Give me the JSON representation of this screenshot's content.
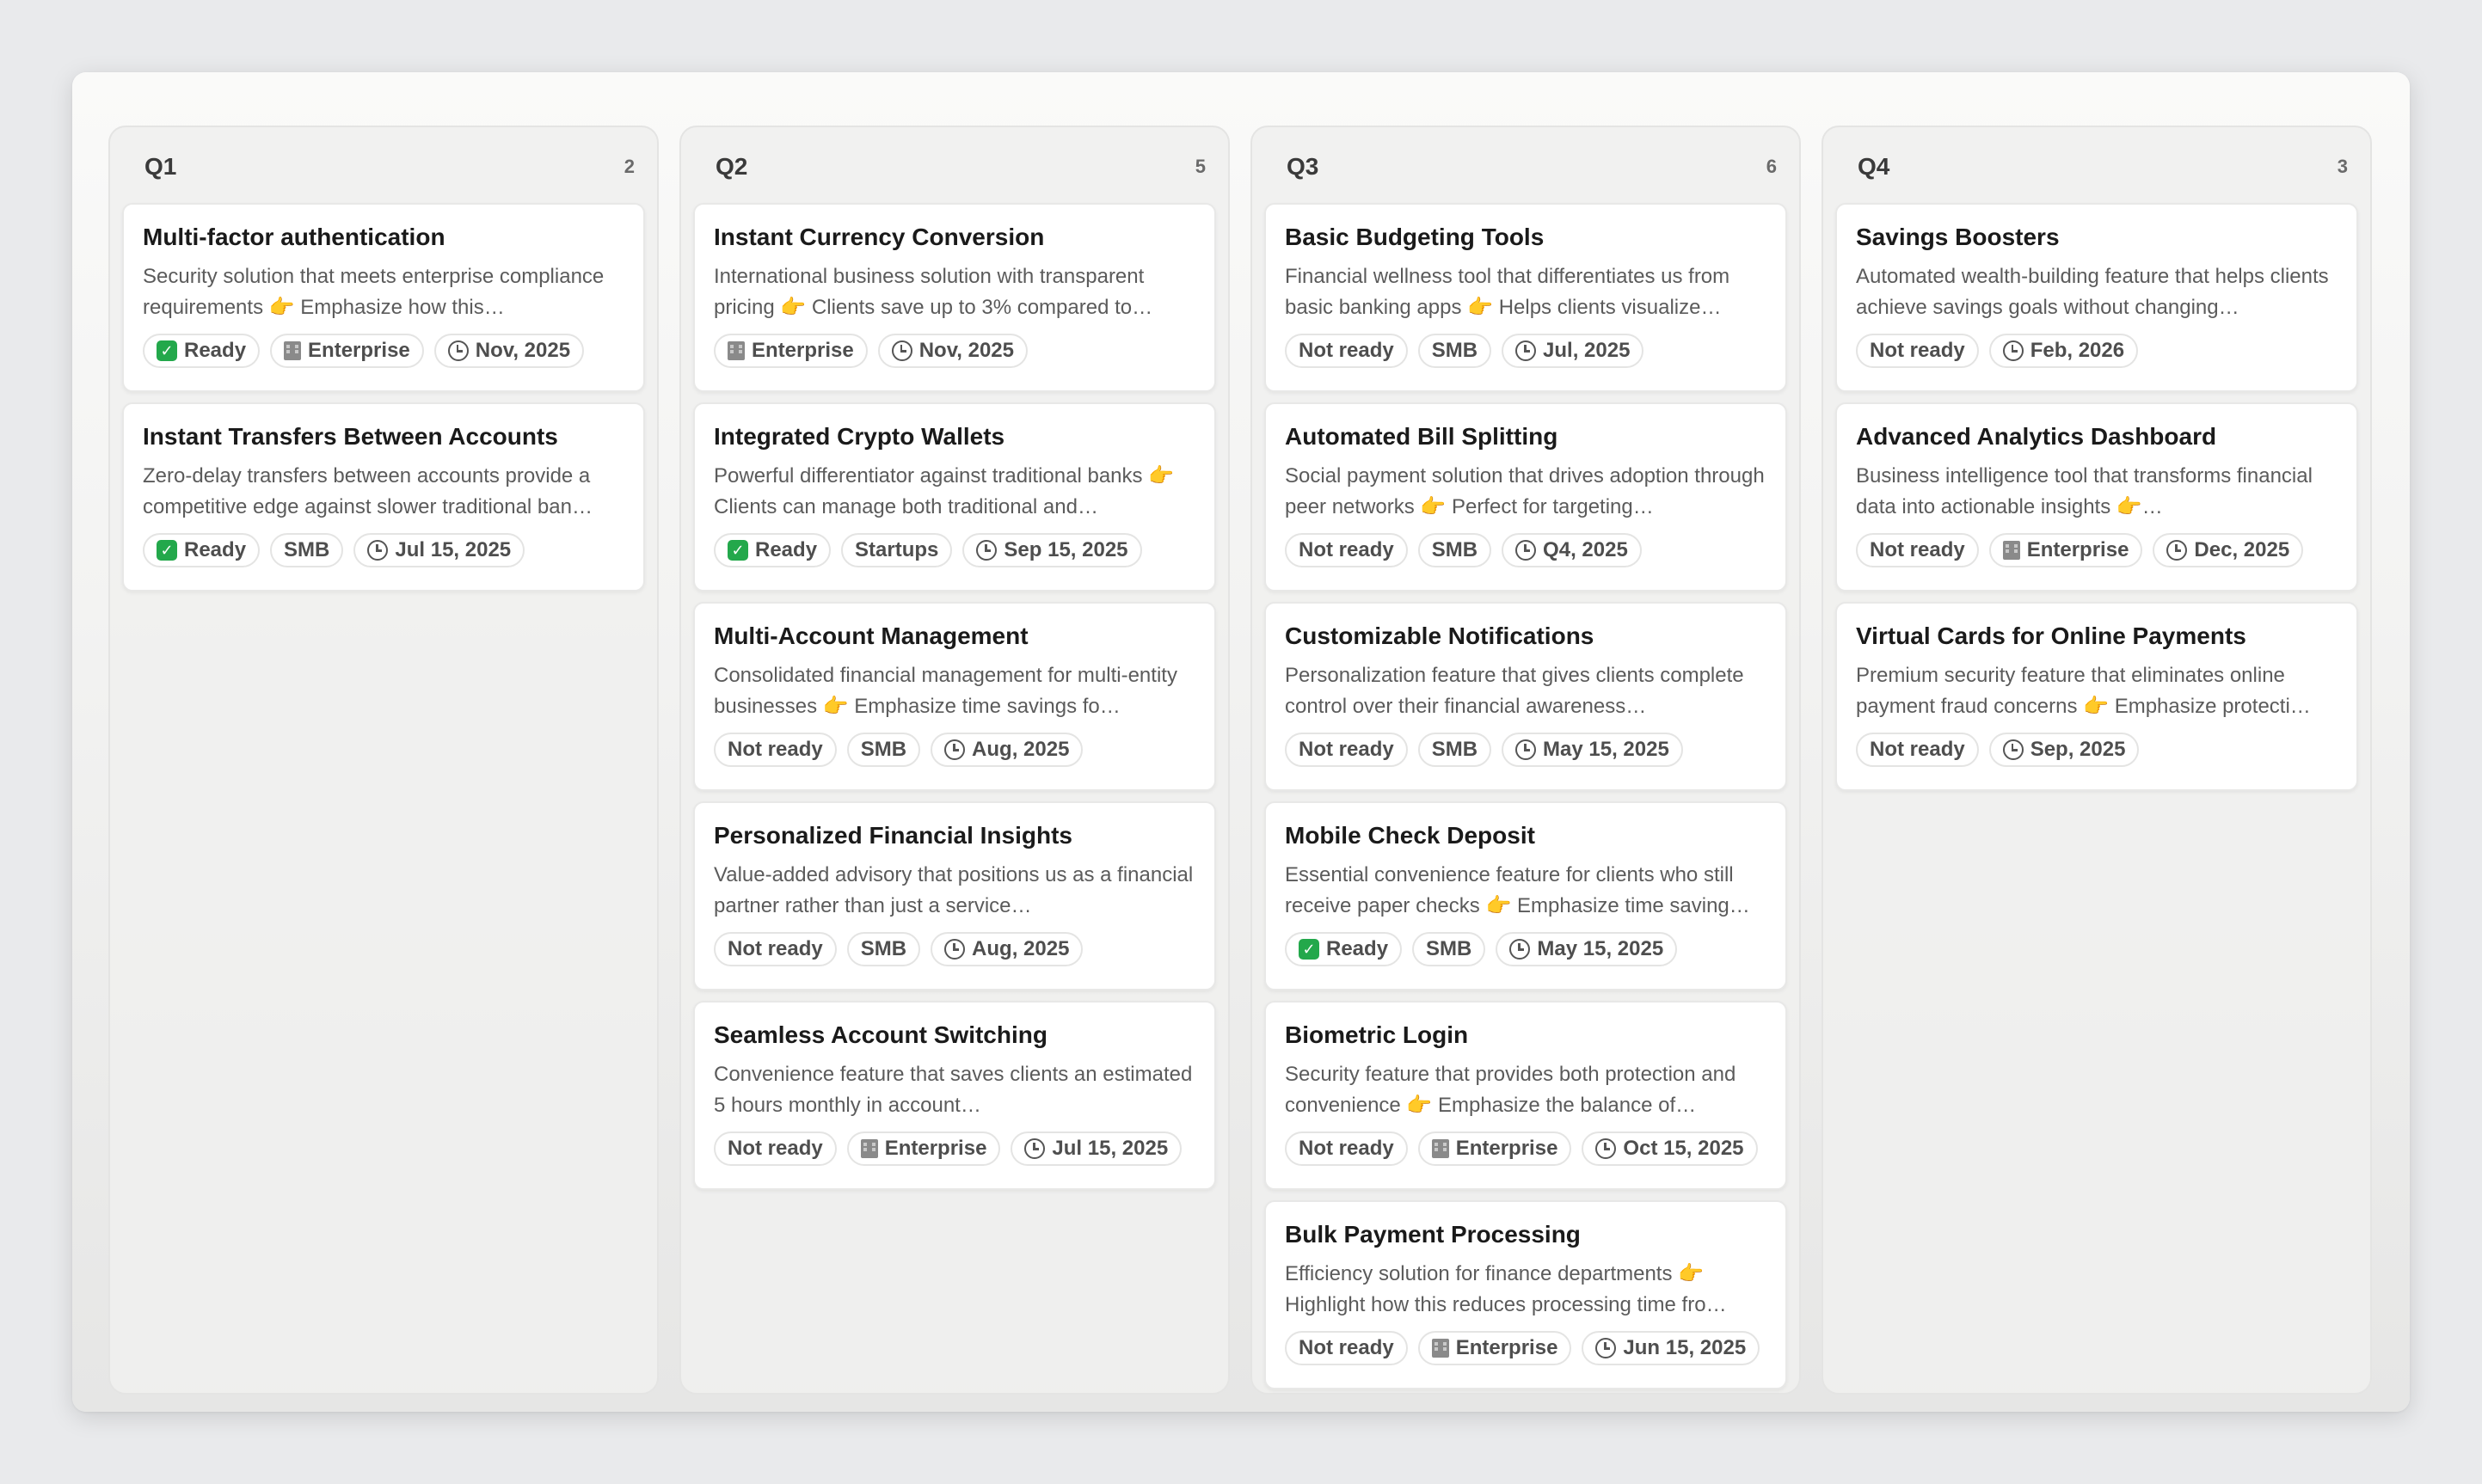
{
  "columns": [
    {
      "title": "Q1",
      "count": "2",
      "cards": [
        {
          "title": "Multi-factor authentication",
          "description": "Security solution that meets enterprise compliance requirements 👉 Emphasize how this…",
          "status": "Ready",
          "segment": "Enterprise",
          "date": "Nov, 2025"
        },
        {
          "title": "Instant Transfers Between Accounts",
          "description": "Zero-delay transfers between accounts provide a competitive edge against slower traditional ban…",
          "status": "Ready",
          "segment": "SMB",
          "date": "Jul 15, 2025"
        }
      ]
    },
    {
      "title": "Q2",
      "count": "5",
      "cards": [
        {
          "title": "Instant Currency Conversion",
          "description": "International business solution with transparent pricing 👉 Clients save up to 3% compared to…",
          "status": null,
          "segment": "Enterprise",
          "date": "Nov, 2025"
        },
        {
          "title": "Integrated Crypto Wallets",
          "description": "Powerful differentiator against traditional banks 👉 Clients can manage both traditional and…",
          "status": "Ready",
          "segment": "Startups",
          "date": "Sep 15, 2025"
        },
        {
          "title": "Multi-Account Management",
          "description": "Consolidated financial management for multi-entity businesses 👉 Emphasize time savings fo…",
          "status": "Not ready",
          "segment": "SMB",
          "date": "Aug, 2025"
        },
        {
          "title": "Personalized Financial Insights",
          "description": "Value-added advisory that positions us as a financial partner rather than just a service…",
          "status": "Not ready",
          "segment": "SMB",
          "date": "Aug, 2025"
        },
        {
          "title": "Seamless Account Switching",
          "description": "Convenience feature that saves clients an estimated 5 hours monthly in account…",
          "status": "Not ready",
          "segment": "Enterprise",
          "date": "Jul 15, 2025"
        }
      ]
    },
    {
      "title": "Q3",
      "count": "6",
      "cards": [
        {
          "title": "Basic Budgeting Tools",
          "description": "Financial wellness tool that differentiates us from basic banking apps 👉 Helps clients visualize…",
          "status": "Not ready",
          "segment": "SMB",
          "date": "Jul, 2025"
        },
        {
          "title": "Automated Bill Splitting",
          "description": "Social payment solution that drives adoption through peer networks 👉 Perfect for targeting…",
          "status": "Not ready",
          "segment": "SMB",
          "date": "Q4, 2025"
        },
        {
          "title": "Customizable Notifications",
          "description": "Personalization feature that gives clients complete control over their financial awareness…",
          "status": "Not ready",
          "segment": "SMB",
          "date": "May 15, 2025"
        },
        {
          "title": "Mobile Check Deposit",
          "description": "Essential convenience feature for clients who still receive paper checks 👉 Emphasize time saving…",
          "status": "Ready",
          "segment": "SMB",
          "date": "May 15, 2025"
        },
        {
          "title": "Biometric Login",
          "description": "Security feature that provides both protection and convenience 👉 Emphasize the balance of…",
          "status": "Not ready",
          "segment": "Enterprise",
          "date": "Oct 15, 2025"
        },
        {
          "title": "Bulk Payment Processing",
          "description": "Efficiency solution for finance departments 👉 Highlight how this reduces processing time fro…",
          "status": "Not ready",
          "segment": "Enterprise",
          "date": "Jun 15, 2025"
        }
      ]
    },
    {
      "title": "Q4",
      "count": "3",
      "cards": [
        {
          "title": "Savings Boosters",
          "description": "Automated wealth-building feature that helps clients achieve savings goals without changing…",
          "status": "Not ready",
          "segment": null,
          "date": "Feb, 2026"
        },
        {
          "title": "Advanced Analytics Dashboard",
          "description": "Business intelligence tool that transforms financial data into actionable insights 👉…",
          "status": "Not ready",
          "segment": "Enterprise",
          "date": "Dec, 2025"
        },
        {
          "title": "Virtual Cards for Online Payments",
          "description": "Premium security feature that eliminates online payment fraud concerns 👉 Emphasize protecti…",
          "status": "Not ready",
          "segment": null,
          "date": "Sep, 2025"
        }
      ]
    }
  ],
  "icons": {
    "ready": "check-box-icon",
    "enterprise": "building-icon",
    "date": "clock-icon"
  },
  "colors": {
    "ready_green": "#23a84b",
    "background": "#e9eaec"
  }
}
